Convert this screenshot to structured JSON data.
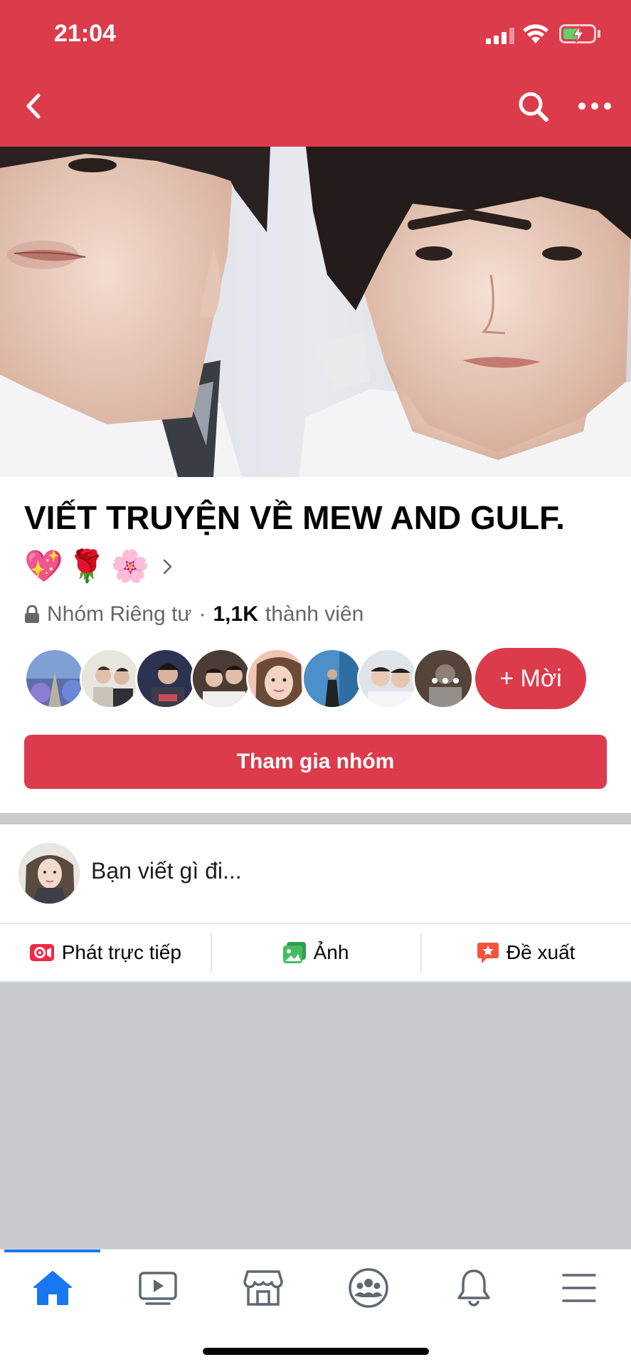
{
  "status_bar": {
    "time": "21:04"
  },
  "group": {
    "title": "VIẾT TRUYỆN VỀ MEW AND GULF.",
    "emojis": [
      "💖",
      "🌹",
      "🌸"
    ],
    "privacy_label": "Nhóm Riêng tư",
    "separator": "·",
    "member_count": "1,1K",
    "members_label": "thành viên",
    "invite_label": "+ Mời",
    "join_label": "Tham gia nhóm"
  },
  "composer": {
    "placeholder": "Bạn viết gì đi...",
    "actions": [
      {
        "label": "Phát trực tiếp",
        "icon": "live-video-icon",
        "color": "#f02849"
      },
      {
        "label": "Ảnh",
        "icon": "photo-icon",
        "color": "#45bd62"
      },
      {
        "label": "Đề xuất",
        "icon": "suggest-icon",
        "color": "#f5533d"
      }
    ]
  },
  "bottom_nav": [
    {
      "name": "home",
      "icon": "home-icon",
      "active": true
    },
    {
      "name": "watch",
      "icon": "video-icon",
      "active": false
    },
    {
      "name": "marketplace",
      "icon": "marketplace-icon",
      "active": false
    },
    {
      "name": "groups",
      "icon": "groups-icon",
      "active": false
    },
    {
      "name": "notifications",
      "icon": "bell-icon",
      "active": false
    },
    {
      "name": "menu",
      "icon": "menu-icon",
      "active": false
    }
  ],
  "colors": {
    "brand_red": "#dc3b4c",
    "nav_active": "#1877f2",
    "text_secondary": "#65676b",
    "feed_gray": "#c9cacf"
  }
}
